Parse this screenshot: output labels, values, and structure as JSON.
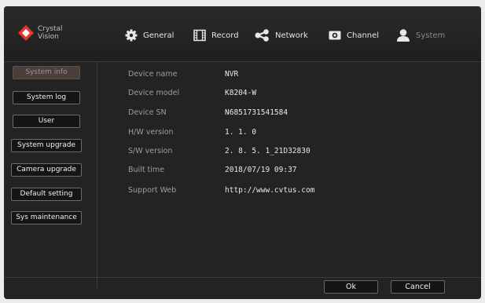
{
  "brand": {
    "name_line1": "Crystal",
    "name_line2": "Vision",
    "accent": "#e23a2a"
  },
  "nav": [
    {
      "label": "General",
      "icon": "gear-icon"
    },
    {
      "label": "Record",
      "icon": "film-icon"
    },
    {
      "label": "Network",
      "icon": "network-share-icon"
    },
    {
      "label": "Channel",
      "icon": "camera-icon"
    },
    {
      "label": "System",
      "icon": "user-icon",
      "active": true
    }
  ],
  "sidebar": {
    "items": [
      {
        "label": "System info",
        "active": true
      },
      {
        "label": "System log"
      },
      {
        "label": "User"
      },
      {
        "label": "System upgrade"
      },
      {
        "label": "Camera upgrade"
      },
      {
        "label": "Default setting"
      },
      {
        "label": "Sys maintenance"
      }
    ]
  },
  "info": [
    {
      "label": "Device name",
      "value": "NVR"
    },
    {
      "label": "Device model",
      "value": "K8204-W"
    },
    {
      "label": "Device SN",
      "value": "N6851731541584"
    },
    {
      "label": "H/W version",
      "value": "1. 1. 0"
    },
    {
      "label": "S/W version",
      "value": "2. 8. 5. 1_21D32830"
    },
    {
      "label": "Built time",
      "value": "2018/07/19 09:37"
    },
    {
      "label": "Support Web",
      "value": "http://www.cvtus.com"
    }
  ],
  "footer": {
    "ok_label": "Ok",
    "cancel_label": "Cancel"
  }
}
